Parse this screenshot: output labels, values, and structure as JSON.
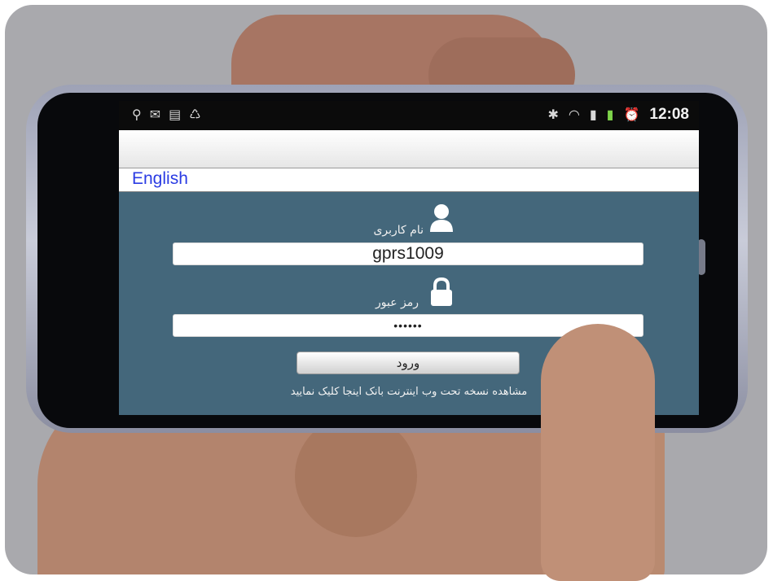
{
  "statusbar": {
    "left_icons": [
      "usb-icon",
      "mail-icon",
      "trash-icon",
      "recycle-icon"
    ],
    "right_icons": [
      "bluetooth-icon",
      "wifi-icon",
      "signal-icon",
      "battery-icon",
      "alarm-icon"
    ],
    "time": "12:08"
  },
  "langbar": {
    "link": "English"
  },
  "form": {
    "username_label": "نام کاربری",
    "username_value": "gprs1009",
    "password_label": "رمز عبور",
    "password_value": "••••••",
    "login_label": "ورود"
  },
  "footer": {
    "note": "مشاهده نسخه تحت وب اینترنت بانک اینجا کلیک نمایید"
  },
  "colors": {
    "screen_bg": "#44677b",
    "link": "#2a3be3",
    "status_bg": "#0b0b0b"
  }
}
